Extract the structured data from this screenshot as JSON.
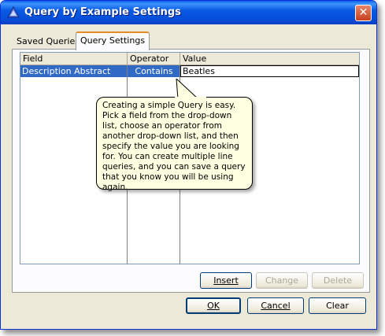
{
  "window": {
    "title": "Query by Example Settings",
    "close_glyph": "✕"
  },
  "tabs": [
    {
      "label": "Saved Queries",
      "selected": false
    },
    {
      "label": "Query Settings",
      "selected": true
    }
  ],
  "grid": {
    "columns": [
      "Field",
      "Operator",
      "Value"
    ],
    "rows": [
      {
        "field": "Description Abstract",
        "operator": "Contains",
        "value": "Beatles"
      }
    ]
  },
  "panel_buttons": {
    "insert": "Insert",
    "change": "Change",
    "delete": "Delete"
  },
  "dialog_buttons": {
    "ok": "OK",
    "cancel": "Cancel",
    "clear": "Clear"
  },
  "tooltip": {
    "text": "Creating a simple Query is easy. Pick a field from the drop-down list, choose an operator from another drop-down list, and then specify the value you are looking for. You can create multiple line queries, and you can save a query that you know you will be using again."
  },
  "colors": {
    "title_bar": "#0a5ae2",
    "selection": "#316ac5",
    "tooltip_bg": "#ffffe1",
    "tab_highlight": "#e68b2c",
    "close_button": "#c7401e"
  },
  "icons": {
    "title": "app-triangle-icon",
    "close": "close-icon"
  }
}
